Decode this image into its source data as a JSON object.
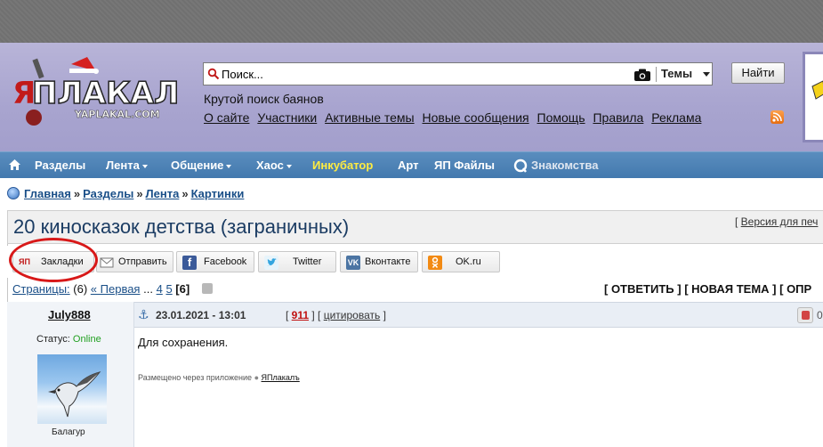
{
  "search": {
    "placeholder": "Поиск...",
    "scope": "Темы",
    "button": "Найти"
  },
  "header": {
    "logo_text": "ЯПЛАКАЛ",
    "logo_sub": "YAPLAKAL.COM",
    "tagline": "Крутой поиск баянов",
    "links": [
      "О сайте",
      "Участники",
      "Активные темы",
      "Новые сообщения",
      "Помощь",
      "Правила",
      "Реклама"
    ]
  },
  "nav": {
    "items": [
      "Разделы",
      "Лента",
      "Общение",
      "Хаос",
      "Инкубатор",
      "Арт",
      "ЯП Файлы",
      "Знакомства"
    ]
  },
  "breadcrumb": [
    "Главная",
    "Разделы",
    "Лента",
    "Картинки"
  ],
  "topic": {
    "title": "20 киносказок детства (заграничных)",
    "print_version": "Версия для печ"
  },
  "share": {
    "bookmarks": "Закладки",
    "bookmarks_icon_text": "ЯП",
    "send": "Отправить",
    "facebook": "Facebook",
    "twitter": "Twitter",
    "vkontakte": "Вконтакте",
    "ok": "OK.ru"
  },
  "pages": {
    "label": "Страницы:",
    "count": "(6)",
    "first": "« Первая",
    "ellipsis": "...",
    "p4": "4",
    "p5": "5",
    "current": "[6]"
  },
  "actions": {
    "reply": "[ ОТВЕТИТЬ ]",
    "new_topic": "[ НОВАЯ ТЕМА ]",
    "more": "[ ОПР"
  },
  "post": {
    "author": "July888",
    "date": "23.01.2021 - 13:01",
    "number": "911",
    "quote": "цитировать",
    "status_label": "Статус:",
    "status_value": "Online",
    "rank": "Балагур",
    "body": "Для сохранения.",
    "via_prefix": "Размещено через приложение",
    "via_app": "ЯПлакалъ",
    "vote_extra": "0"
  },
  "colors": {
    "header_bg": "#a8a4cf",
    "nav_bg": "#4a7fb3",
    "link": "#1a4f88",
    "online": "#22a022",
    "highlight": "#d81818"
  }
}
